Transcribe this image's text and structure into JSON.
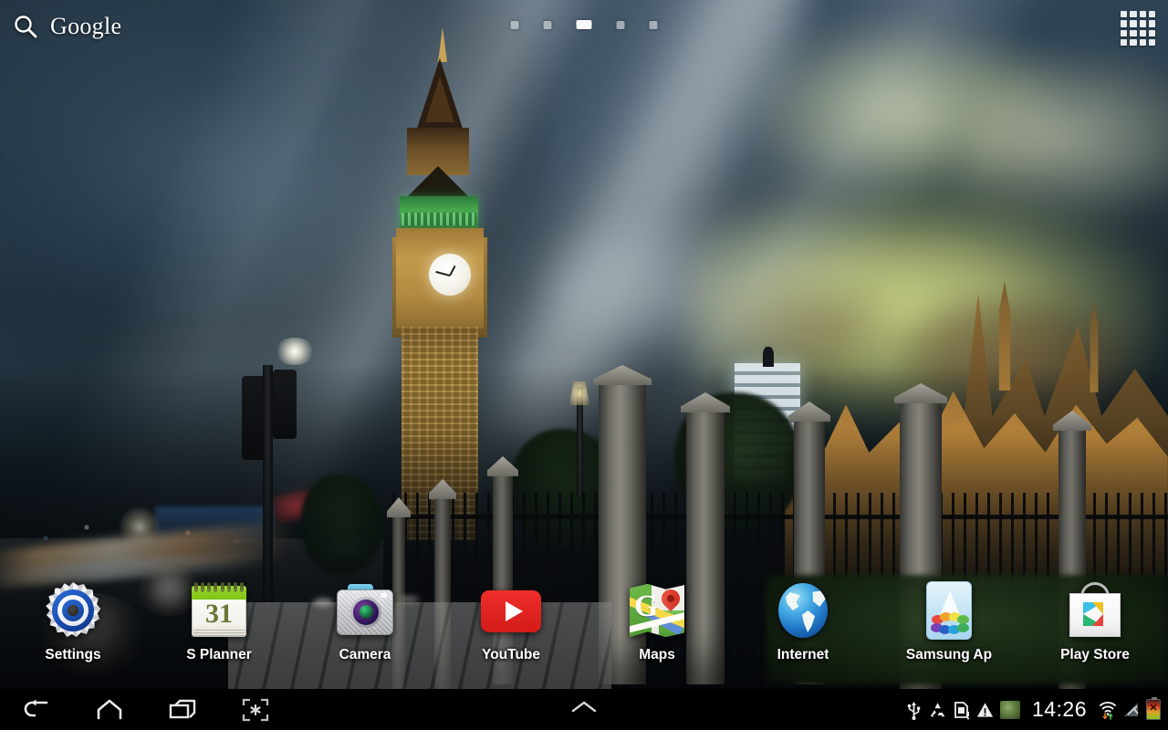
{
  "device": {
    "platform": "android-tablet-home-screen",
    "wallpaper_description": "Big Ben and the Houses of Parliament, London, at night under a dramatic cloudy sky with light rays"
  },
  "topbar": {
    "search": {
      "icon": "search-icon",
      "brand_label": "Google",
      "placeholder": "Google"
    },
    "apps_grid": {
      "icon": "apps-grid-icon",
      "label": "Apps"
    },
    "page_indicator": {
      "total_pages": 5,
      "active_page": 3,
      "dots": [
        {
          "index": 1,
          "active": false
        },
        {
          "index": 2,
          "active": false
        },
        {
          "index": 3,
          "active": true
        },
        {
          "index": 4,
          "active": false
        },
        {
          "index": 5,
          "active": false
        }
      ]
    }
  },
  "dock": {
    "apps": [
      {
        "label": "Settings",
        "icon": "settings-gear-icon"
      },
      {
        "label": "S Planner",
        "icon": "calendar-icon",
        "badge_number": "31"
      },
      {
        "label": "Camera",
        "icon": "camera-icon"
      },
      {
        "label": "YouTube",
        "icon": "youtube-icon"
      },
      {
        "label": "Maps",
        "icon": "maps-icon",
        "glyph": "G"
      },
      {
        "label": "Internet",
        "icon": "globe-icon"
      },
      {
        "label": "Samsung Ap",
        "icon": "samsung-apps-icon"
      },
      {
        "label": "Play Store",
        "icon": "play-store-icon"
      }
    ]
  },
  "navbar": {
    "buttons": [
      {
        "name": "back",
        "icon": "back-arrow-icon"
      },
      {
        "name": "home",
        "icon": "home-icon"
      },
      {
        "name": "recents",
        "icon": "recent-apps-icon"
      },
      {
        "name": "screenshot",
        "icon": "screen-capture-icon"
      }
    ],
    "center_handle": {
      "icon": "chevron-up-icon"
    },
    "status": {
      "time": "14:26",
      "icons": [
        {
          "name": "usb-icon",
          "label": "USB connected"
        },
        {
          "name": "sync-recycle-icon",
          "label": "Sync"
        },
        {
          "name": "sd-card-alert-icon",
          "label": "SD card"
        },
        {
          "name": "warning-triangle-icon",
          "label": "Warning"
        },
        {
          "name": "image-thumbnail-icon",
          "label": "Screenshot captured"
        }
      ],
      "right_icons": [
        {
          "name": "wifi-transfer-icon",
          "label": "Wi-Fi"
        },
        {
          "name": "no-signal-icon",
          "label": "No signal"
        },
        {
          "name": "battery-icon",
          "label": "Battery"
        }
      ]
    }
  },
  "colors": {
    "youtube_red": "#ef2e2a",
    "settings_blue": "#1748a8",
    "calendar_green": "#9ad82e",
    "globe_blue": "#1f74c4",
    "nav_bar_black": "#000000",
    "label_white": "#ffffff"
  }
}
